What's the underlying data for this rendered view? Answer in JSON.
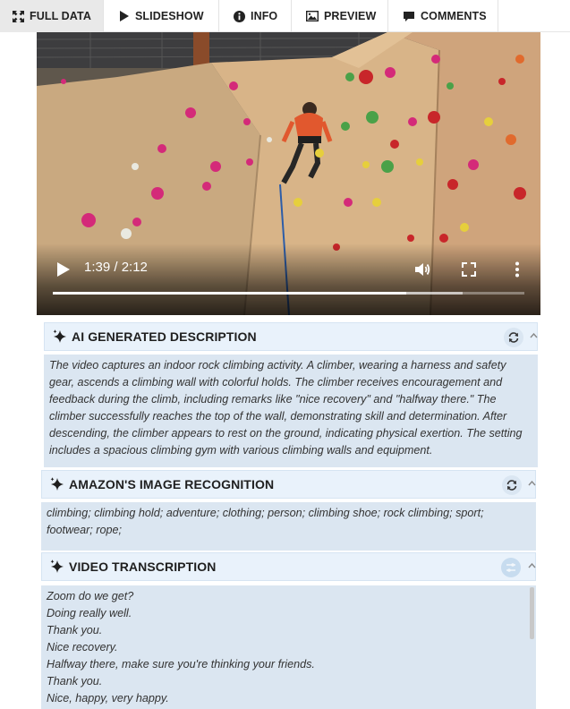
{
  "tabs": [
    {
      "label": "FULL DATA",
      "icon": "expand-arrows-icon",
      "active": true
    },
    {
      "label": "SLIDESHOW",
      "icon": "play-triangle-icon",
      "active": false
    },
    {
      "label": "INFO",
      "icon": "info-circle-icon",
      "active": false
    },
    {
      "label": "PREVIEW",
      "icon": "image-icon",
      "active": false
    },
    {
      "label": "COMMENTS",
      "icon": "speech-bubble-icon",
      "active": false
    }
  ],
  "video": {
    "time": "1:39 / 2:12",
    "progress_fraction": 0.75,
    "buffered_fraction": 0.87
  },
  "ai_description": {
    "title": "AI GENERATED DESCRIPTION",
    "text": "The video captures an indoor rock climbing activity. A climber, wearing a harness and safety gear, ascends a climbing wall with colorful holds. The climber receives encouragement and feedback during the climb, including remarks like \"nice recovery\" and \"halfway there.\" The climber successfully reaches the top of the wall, demonstrating skill and determination. After descending, the climber appears to rest on the ground, indicating physical exertion. The setting includes a spacious climbing gym with various climbing walls and equipment."
  },
  "image_recognition": {
    "title": "AMAZON'S IMAGE RECOGNITION",
    "text": "climbing; climbing hold; adventure; clothing; person; climbing shoe; rock climbing; sport; footwear; rope;"
  },
  "transcription": {
    "title": "VIDEO TRANSCRIPTION",
    "lines": [
      "Zoom do we get?",
      "Doing really well.",
      "Thank you.",
      "Nice recovery.",
      "Halfway there, make sure you're thinking your friends.",
      "Thank you.",
      "Nice, happy, very happy."
    ]
  },
  "colors": {
    "panel_header": "#e9f2fb",
    "panel_body": "#dbe6f1",
    "active_tab": "#e9e9e9"
  }
}
